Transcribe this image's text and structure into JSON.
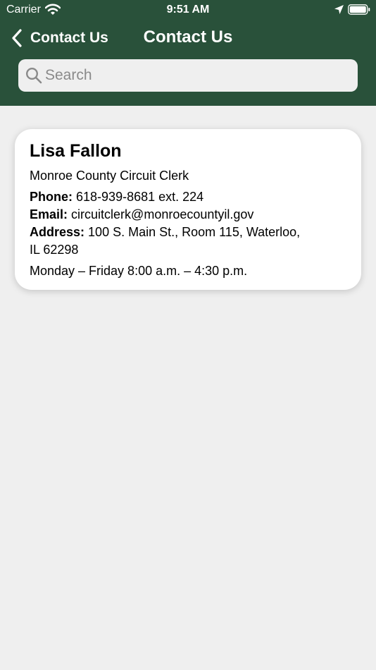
{
  "status_bar": {
    "carrier": "Carrier",
    "time": "9:51 AM"
  },
  "nav": {
    "back_label": "Contact Us",
    "title": "Contact Us"
  },
  "search": {
    "placeholder": "Search",
    "value": ""
  },
  "contact": {
    "name": "Lisa Fallon",
    "title": "Monroe County Circuit Clerk",
    "phone_label": "Phone:",
    "phone": "618-939-8681 ext. 224",
    "email_label": "Email:",
    "email": "circuitclerk@monroecountyil.gov",
    "address_label": "Address:",
    "address_line1": "100 S. Main St., Room 115, Waterloo,",
    "address_line2": "IL 62298",
    "hours": "Monday – Friday 8:00 a.m. – 4:30 p.m."
  },
  "colors": {
    "header_bg": "#29513a",
    "page_bg": "#efefef",
    "card_bg": "#ffffff"
  },
  "icons": [
    "wifi-icon",
    "location-arrow-icon",
    "battery-icon",
    "chevron-left-icon",
    "search-icon"
  ]
}
